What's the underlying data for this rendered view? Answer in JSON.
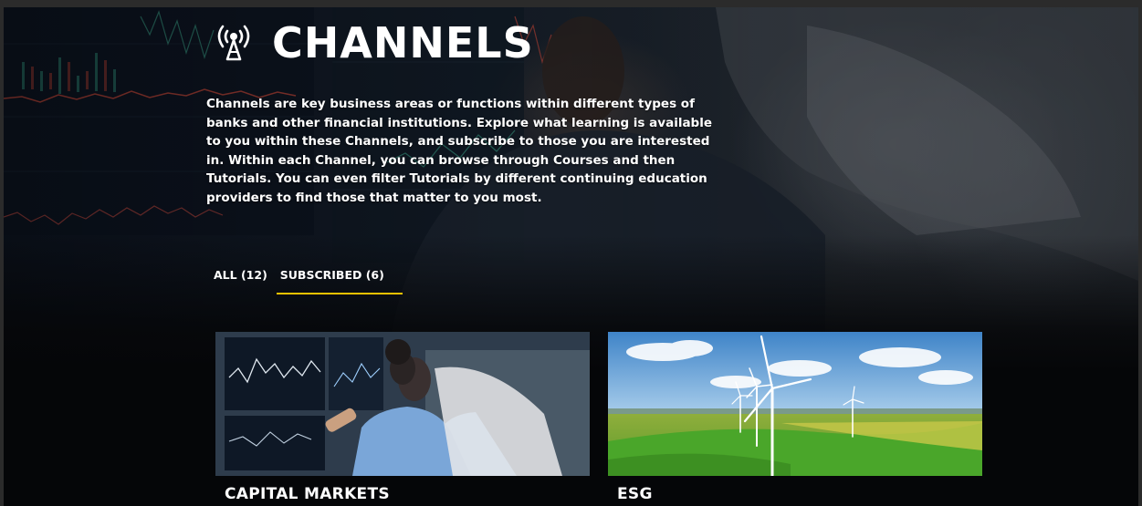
{
  "header": {
    "title": "CHANNELS",
    "icon": "antenna-icon"
  },
  "intro": {
    "text": "Channels are key business areas or functions within different types of banks and other financial institutions. Explore what learning is available to you within these Channels, and subscribe to those you are interested in. Within each Channel, you can browse through Courses and then Tutorials. You can even filter Tutorials by different continuing education providers to find those that matter to you most."
  },
  "tabs": [
    {
      "label": "ALL (12)",
      "active": false
    },
    {
      "label": "SUBSCRIBED (6)",
      "active": true
    }
  ],
  "cards": [
    {
      "title": "CAPITAL MARKETS",
      "image": "traders-at-monitors"
    },
    {
      "title": "ESG",
      "image": "wind-turbines-field"
    }
  ],
  "colors": {
    "tab_underline": "#f2c200",
    "page_background": "#050608",
    "text": "#ffffff"
  }
}
